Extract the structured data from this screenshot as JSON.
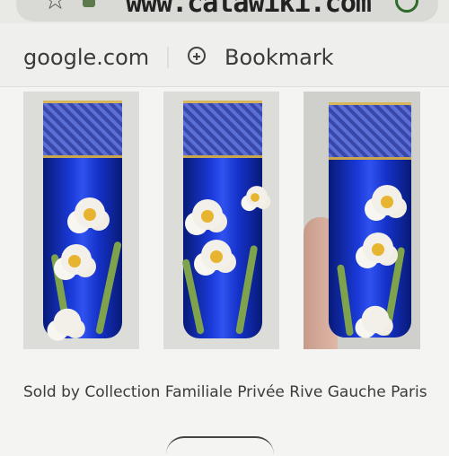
{
  "browser": {
    "url": "www.catawiki.com",
    "icons": [
      "star-icon",
      "info-icon",
      "reload-icon"
    ]
  },
  "source_bar": {
    "domain": "google.com",
    "bookmark_label": "Bookmark",
    "bookmark_icon": "plus-circle-icon"
  },
  "gallery": {
    "images": [
      {
        "name": "vase-image-1"
      },
      {
        "name": "vase-image-2"
      },
      {
        "name": "vase-image-3"
      }
    ]
  },
  "listing": {
    "seller_text": "Sold by Collection Familiale Privée Rive Gauche Paris"
  }
}
